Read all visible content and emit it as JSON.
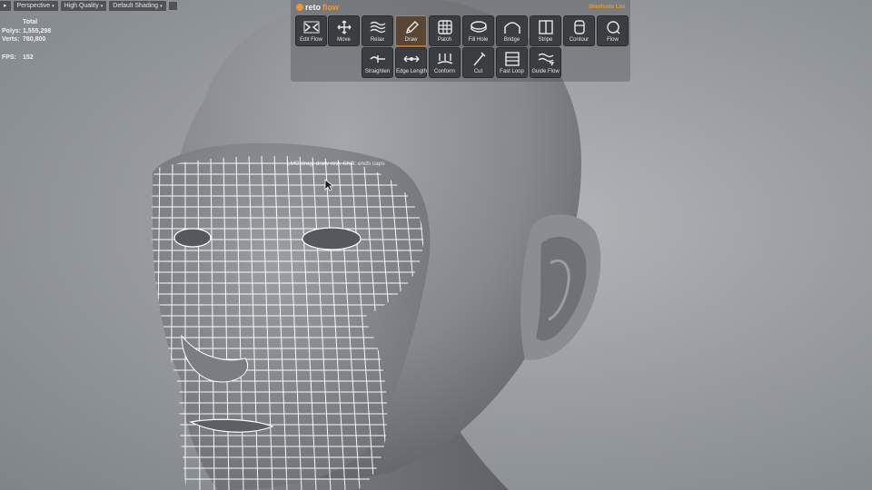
{
  "viewport_menu": {
    "left_arrow": "▸",
    "items": [
      "Perspective",
      "High Quality",
      "Default Shading"
    ],
    "caret": "▾"
  },
  "stats": {
    "header": "Total",
    "polys_label": "Polys:",
    "polys_value": "1,555,298",
    "verts_label": "Verts:",
    "verts_value": "780,800",
    "fps_label": "FPS:",
    "fps_value": "152"
  },
  "brand": {
    "name_a": "reto",
    "name_b": "flow"
  },
  "shortcuts_label": "Shortcuts List",
  "tools_row1": [
    {
      "label": "Edit Flow",
      "icon": "edit-flow-icon"
    },
    {
      "label": "Move",
      "icon": "move-icon"
    },
    {
      "label": "Relax",
      "icon": "relax-icon"
    },
    {
      "label": "Draw",
      "icon": "draw-icon",
      "active": true
    },
    {
      "label": "Patch",
      "icon": "patch-icon"
    },
    {
      "label": "Fill Hole",
      "icon": "fill-hole-icon"
    },
    {
      "label": "Bridge",
      "icon": "bridge-icon"
    },
    {
      "label": "Stripe",
      "icon": "stripe-icon"
    },
    {
      "label": "Contour",
      "icon": "contour-icon"
    },
    {
      "label": "Flow",
      "icon": "flow-icon"
    }
  ],
  "tools_row2": [
    {
      "label": "Straighten",
      "icon": "straighten-icon"
    },
    {
      "label": "Edge Length",
      "icon": "edge-length-icon"
    },
    {
      "label": "Conform",
      "icon": "conform-icon"
    },
    {
      "label": "Cut",
      "icon": "cut-icon"
    },
    {
      "label": "Fast Loop",
      "icon": "fast-loop-icon"
    },
    {
      "label": "Guide Flow",
      "icon": "guide-flow-icon"
    }
  ],
  "tooltip": "LMB drag: draw row. Shift: ends caps",
  "colors": {
    "accent": "#e49a3c",
    "button_bg": "#3b3d40",
    "mesh": "#ffffff",
    "head": "#8f9296"
  }
}
